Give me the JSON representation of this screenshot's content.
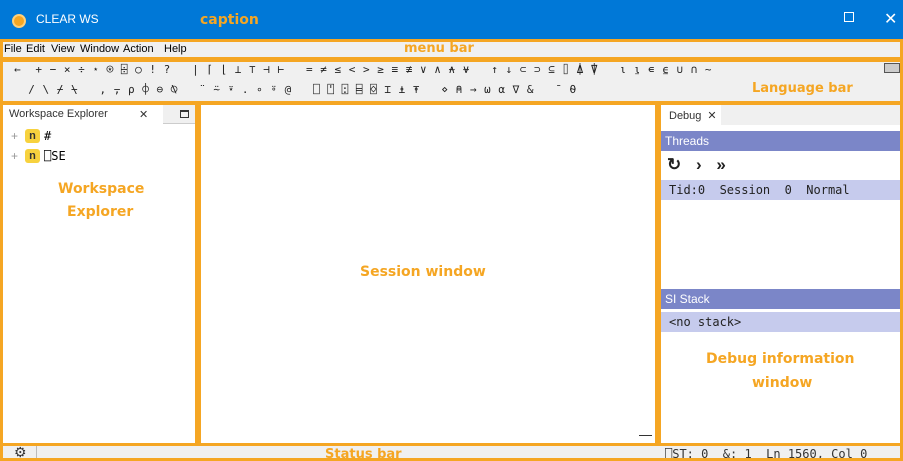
{
  "caption": {
    "app_title": "CLEAR WS",
    "maximize_glyph": "",
    "close_glyph": "✕"
  },
  "annotations": {
    "caption": "caption",
    "menu_bar": "menu bar",
    "language_bar": "Language bar",
    "workspace_explorer_line1": "Workspace",
    "workspace_explorer_line2": "Explorer",
    "session_window": "Session window",
    "debug_line1": "Debug information",
    "debug_line2": "window",
    "status_bar": "Status bar"
  },
  "menu": {
    "items": [
      "File",
      "Edit",
      "View",
      "Window",
      "Action",
      "Help"
    ]
  },
  "language_bar": {
    "row1": "←  + − × ÷ ⋆ ⍟ ⌹ ○ ! ?   | ⌈ ⌊ ⊥ ⊤ ⊣ ⊢   = ≠ ≤ < > ≥ ≡ ≢ ∨ ∧ ⍲ ⍱   ↑ ↓ ⊂ ⊃ ⊆ ⌷ ⍋ ⍒   ⍳ ⍸ ∊ ⍷ ∪ ∩ ~",
    "row2": "  / \\ ⌿ ⍀   , ⍪ ⍴ ⌽ ⊖ ⍉   ¨ ⍨ ⍣ . ∘ ⍤ @   ⎕ ⍞ ⍠ ⌸ ⌺ ⌶ ⍎ ⍕   ⋄ ⍝ → ⍵ ⍺ ∇ &   ¯ ⍬",
    "keyboard_icon": "keyboard-icon"
  },
  "workspace": {
    "tab_label": "Workspace Explorer",
    "tab_close": "✕",
    "items": [
      {
        "badge": "n",
        "name": "#"
      },
      {
        "badge": "n",
        "name": "⎕SE"
      }
    ],
    "expand_glyph": "+"
  },
  "debug": {
    "tab_label": "Debug",
    "tab_close": "✕",
    "threads_header": "Threads",
    "tools": [
      "↻",
      "›",
      "»"
    ],
    "thread_row": "Tid:0  Session  0  Normal",
    "si_header": "SI Stack",
    "si_row": "<no stack>"
  },
  "status": {
    "info": "⎕ST: 0  &: 1  Ln 1560, Col 0",
    "gear_icon": "gear-icon"
  },
  "colors": {
    "titlebar": "#0078d7",
    "annotation": "#f5a623",
    "debug_header": "#7b86c8",
    "debug_row": "#c6cbed",
    "namespace_badge": "#f7d23e"
  }
}
